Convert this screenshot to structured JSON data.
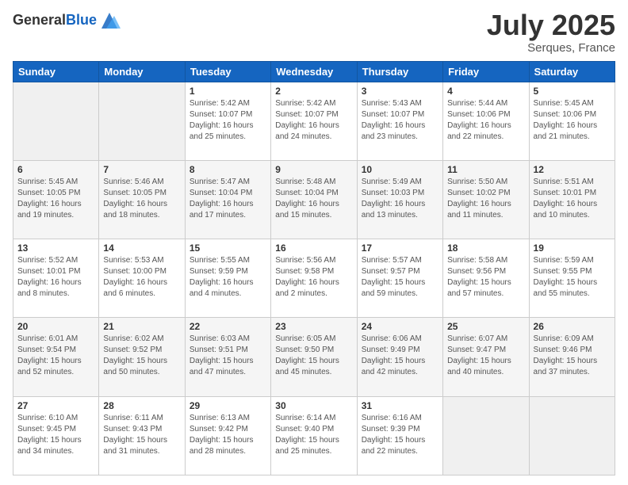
{
  "header": {
    "logo_general": "General",
    "logo_blue": "Blue",
    "month": "July 2025",
    "location": "Serques, France"
  },
  "days_of_week": [
    "Sunday",
    "Monday",
    "Tuesday",
    "Wednesday",
    "Thursday",
    "Friday",
    "Saturday"
  ],
  "weeks": [
    [
      {
        "day": "",
        "info": ""
      },
      {
        "day": "",
        "info": ""
      },
      {
        "day": "1",
        "info": "Sunrise: 5:42 AM\nSunset: 10:07 PM\nDaylight: 16 hours\nand 25 minutes."
      },
      {
        "day": "2",
        "info": "Sunrise: 5:42 AM\nSunset: 10:07 PM\nDaylight: 16 hours\nand 24 minutes."
      },
      {
        "day": "3",
        "info": "Sunrise: 5:43 AM\nSunset: 10:07 PM\nDaylight: 16 hours\nand 23 minutes."
      },
      {
        "day": "4",
        "info": "Sunrise: 5:44 AM\nSunset: 10:06 PM\nDaylight: 16 hours\nand 22 minutes."
      },
      {
        "day": "5",
        "info": "Sunrise: 5:45 AM\nSunset: 10:06 PM\nDaylight: 16 hours\nand 21 minutes."
      }
    ],
    [
      {
        "day": "6",
        "info": "Sunrise: 5:45 AM\nSunset: 10:05 PM\nDaylight: 16 hours\nand 19 minutes."
      },
      {
        "day": "7",
        "info": "Sunrise: 5:46 AM\nSunset: 10:05 PM\nDaylight: 16 hours\nand 18 minutes."
      },
      {
        "day": "8",
        "info": "Sunrise: 5:47 AM\nSunset: 10:04 PM\nDaylight: 16 hours\nand 17 minutes."
      },
      {
        "day": "9",
        "info": "Sunrise: 5:48 AM\nSunset: 10:04 PM\nDaylight: 16 hours\nand 15 minutes."
      },
      {
        "day": "10",
        "info": "Sunrise: 5:49 AM\nSunset: 10:03 PM\nDaylight: 16 hours\nand 13 minutes."
      },
      {
        "day": "11",
        "info": "Sunrise: 5:50 AM\nSunset: 10:02 PM\nDaylight: 16 hours\nand 11 minutes."
      },
      {
        "day": "12",
        "info": "Sunrise: 5:51 AM\nSunset: 10:01 PM\nDaylight: 16 hours\nand 10 minutes."
      }
    ],
    [
      {
        "day": "13",
        "info": "Sunrise: 5:52 AM\nSunset: 10:01 PM\nDaylight: 16 hours\nand 8 minutes."
      },
      {
        "day": "14",
        "info": "Sunrise: 5:53 AM\nSunset: 10:00 PM\nDaylight: 16 hours\nand 6 minutes."
      },
      {
        "day": "15",
        "info": "Sunrise: 5:55 AM\nSunset: 9:59 PM\nDaylight: 16 hours\nand 4 minutes."
      },
      {
        "day": "16",
        "info": "Sunrise: 5:56 AM\nSunset: 9:58 PM\nDaylight: 16 hours\nand 2 minutes."
      },
      {
        "day": "17",
        "info": "Sunrise: 5:57 AM\nSunset: 9:57 PM\nDaylight: 15 hours\nand 59 minutes."
      },
      {
        "day": "18",
        "info": "Sunrise: 5:58 AM\nSunset: 9:56 PM\nDaylight: 15 hours\nand 57 minutes."
      },
      {
        "day": "19",
        "info": "Sunrise: 5:59 AM\nSunset: 9:55 PM\nDaylight: 15 hours\nand 55 minutes."
      }
    ],
    [
      {
        "day": "20",
        "info": "Sunrise: 6:01 AM\nSunset: 9:54 PM\nDaylight: 15 hours\nand 52 minutes."
      },
      {
        "day": "21",
        "info": "Sunrise: 6:02 AM\nSunset: 9:52 PM\nDaylight: 15 hours\nand 50 minutes."
      },
      {
        "day": "22",
        "info": "Sunrise: 6:03 AM\nSunset: 9:51 PM\nDaylight: 15 hours\nand 47 minutes."
      },
      {
        "day": "23",
        "info": "Sunrise: 6:05 AM\nSunset: 9:50 PM\nDaylight: 15 hours\nand 45 minutes."
      },
      {
        "day": "24",
        "info": "Sunrise: 6:06 AM\nSunset: 9:49 PM\nDaylight: 15 hours\nand 42 minutes."
      },
      {
        "day": "25",
        "info": "Sunrise: 6:07 AM\nSunset: 9:47 PM\nDaylight: 15 hours\nand 40 minutes."
      },
      {
        "day": "26",
        "info": "Sunrise: 6:09 AM\nSunset: 9:46 PM\nDaylight: 15 hours\nand 37 minutes."
      }
    ],
    [
      {
        "day": "27",
        "info": "Sunrise: 6:10 AM\nSunset: 9:45 PM\nDaylight: 15 hours\nand 34 minutes."
      },
      {
        "day": "28",
        "info": "Sunrise: 6:11 AM\nSunset: 9:43 PM\nDaylight: 15 hours\nand 31 minutes."
      },
      {
        "day": "29",
        "info": "Sunrise: 6:13 AM\nSunset: 9:42 PM\nDaylight: 15 hours\nand 28 minutes."
      },
      {
        "day": "30",
        "info": "Sunrise: 6:14 AM\nSunset: 9:40 PM\nDaylight: 15 hours\nand 25 minutes."
      },
      {
        "day": "31",
        "info": "Sunrise: 6:16 AM\nSunset: 9:39 PM\nDaylight: 15 hours\nand 22 minutes."
      },
      {
        "day": "",
        "info": ""
      },
      {
        "day": "",
        "info": ""
      }
    ]
  ]
}
